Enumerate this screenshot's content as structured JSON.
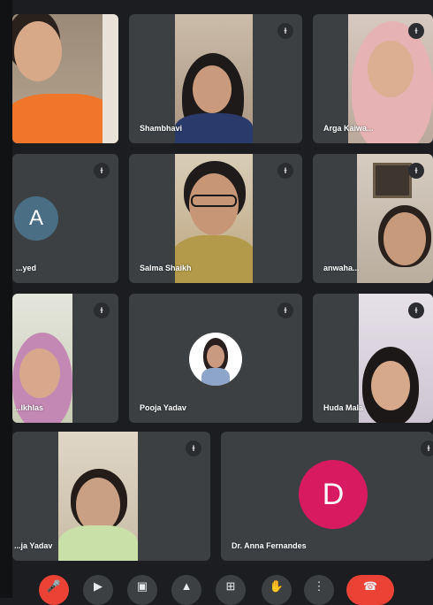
{
  "participants": [
    {
      "name": "",
      "mute": "ɫ"
    },
    {
      "name": "Shambhavi",
      "mute": "ɫ"
    },
    {
      "name": "Arga Kaiwa...",
      "mute": "ɫ"
    },
    {
      "name": "...yed",
      "mute": "ɫ",
      "avatar_letter": "A",
      "avatar_color": "#4a6e84"
    },
    {
      "name": "Salma Shaikh",
      "mute": "ɫ"
    },
    {
      "name": "anwaha...",
      "mute": "ɫ"
    },
    {
      "name": "...Ikhlas",
      "mute": "ɫ"
    },
    {
      "name": "Pooja Yadav",
      "mute": "ɫ"
    },
    {
      "name": "Huda Mala",
      "mute": "ɫ"
    },
    {
      "name": "...ja Yadav",
      "mute": "ɫ"
    },
    {
      "name": "Dr. Anna Fernandes",
      "mute": "ɫ",
      "avatar_letter": "D",
      "avatar_color": "#d81b60"
    }
  ],
  "toolbar": {
    "mic_icon": "mic-off-icon",
    "camera_icon": "camera-icon",
    "captions_icon": "captions-icon",
    "hand_icon": "raise-hand-icon",
    "present_icon": "present-icon",
    "reactions_icon": "reactions-icon",
    "more_icon": "more-options-icon",
    "end_icon": "end-call-icon"
  },
  "colors": {
    "tile": "#3c4043",
    "background": "#1c1d20",
    "end_call": "#ea4335"
  }
}
